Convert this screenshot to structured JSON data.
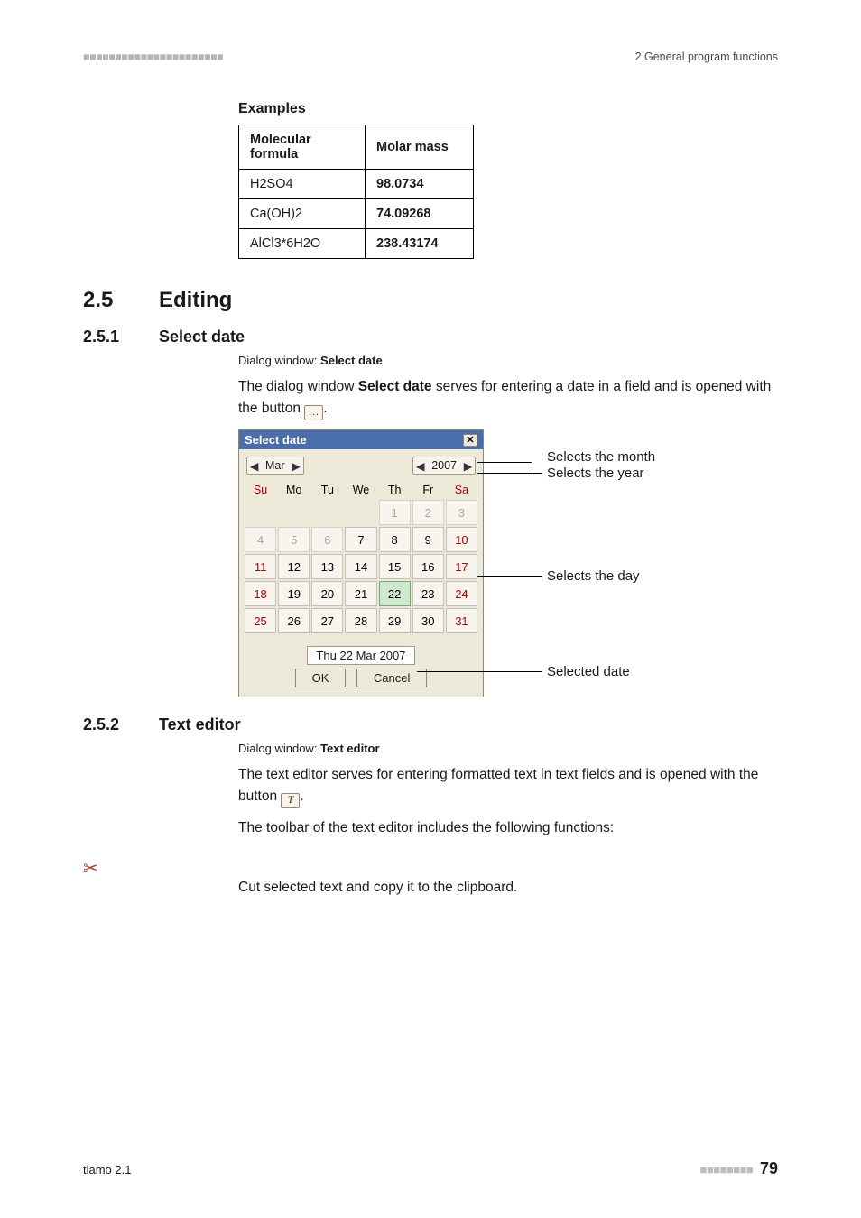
{
  "header": {
    "left_marks": "■■■■■■■■■■■■■■■■■■■■■■",
    "right_text": "2 General program functions"
  },
  "examples": {
    "title": "Examples",
    "col_formula": "Molecular formula",
    "col_mass": "Molar mass",
    "rows": [
      {
        "formula": "H2SO4",
        "mass": "98.0734"
      },
      {
        "formula": "Ca(OH)2",
        "mass": "74.09268"
      },
      {
        "formula": "AlCl3*6H2O",
        "mass": "238.43174"
      }
    ]
  },
  "sec_editing": {
    "num": "2.5",
    "title": "Editing"
  },
  "sec_selectdate": {
    "num": "2.5.1",
    "title": "Select date",
    "dlg_label": "Dialog window: ",
    "dlg_name": "Select date",
    "para1_a": "The dialog window ",
    "para1_b": "Select date",
    "para1_c": " serves for entering a date in a field and is opened with the button ",
    "para1_btn": "…",
    "para1_d": "."
  },
  "cal": {
    "title": "Select date",
    "month": "Mar",
    "year": "2007",
    "dow": [
      "Su",
      "Mo",
      "Tu",
      "We",
      "Th",
      "Fr",
      "Sa"
    ],
    "cells": [
      [
        {
          "n": "",
          "m": true
        },
        {
          "n": "",
          "m": true
        },
        {
          "n": "",
          "m": true
        },
        {
          "n": "",
          "m": true
        },
        {
          "n": "1",
          "m": true
        },
        {
          "n": "2",
          "m": true
        },
        {
          "n": "3",
          "m": true,
          "we": true
        }
      ],
      [
        {
          "n": "4",
          "m": true,
          "we": true
        },
        {
          "n": "5",
          "m": true
        },
        {
          "n": "6",
          "m": true
        },
        {
          "n": "7"
        },
        {
          "n": "8"
        },
        {
          "n": "9"
        },
        {
          "n": "10",
          "we": true
        }
      ],
      [
        {
          "n": "11",
          "we": true
        },
        {
          "n": "12"
        },
        {
          "n": "13"
        },
        {
          "n": "14"
        },
        {
          "n": "15"
        },
        {
          "n": "16"
        },
        {
          "n": "17",
          "we": true
        }
      ],
      [
        {
          "n": "18",
          "we": true
        },
        {
          "n": "19"
        },
        {
          "n": "20"
        },
        {
          "n": "21"
        },
        {
          "n": "22",
          "sel": true
        },
        {
          "n": "23"
        },
        {
          "n": "24",
          "we": true
        }
      ],
      [
        {
          "n": "25",
          "we": true
        },
        {
          "n": "26"
        },
        {
          "n": "27"
        },
        {
          "n": "28"
        },
        {
          "n": "29"
        },
        {
          "n": "30"
        },
        {
          "n": "31",
          "we": true
        }
      ]
    ],
    "selected": "Thu  22 Mar 2007",
    "ok": "OK",
    "cancel": "Cancel"
  },
  "cal_annot": {
    "month": "Selects the month",
    "year": "Selects the year",
    "day": "Selects the day",
    "seldate": "Selected date"
  },
  "sec_texteditor": {
    "num": "2.5.2",
    "title": "Text editor",
    "dlg_label": "Dialog window: ",
    "dlg_name": "Text editor",
    "para1_a": "The text editor serves for entering formatted text in text fields and is opened with the button ",
    "para1_btn": "T",
    "para1_b": ".",
    "para2": "The toolbar of the text editor includes the following functions:",
    "cut": "Cut selected text and copy it to the clipboard."
  },
  "footer": {
    "product": "tiamo 2.1",
    "dashes": "■■■■■■■■",
    "page": "79"
  }
}
